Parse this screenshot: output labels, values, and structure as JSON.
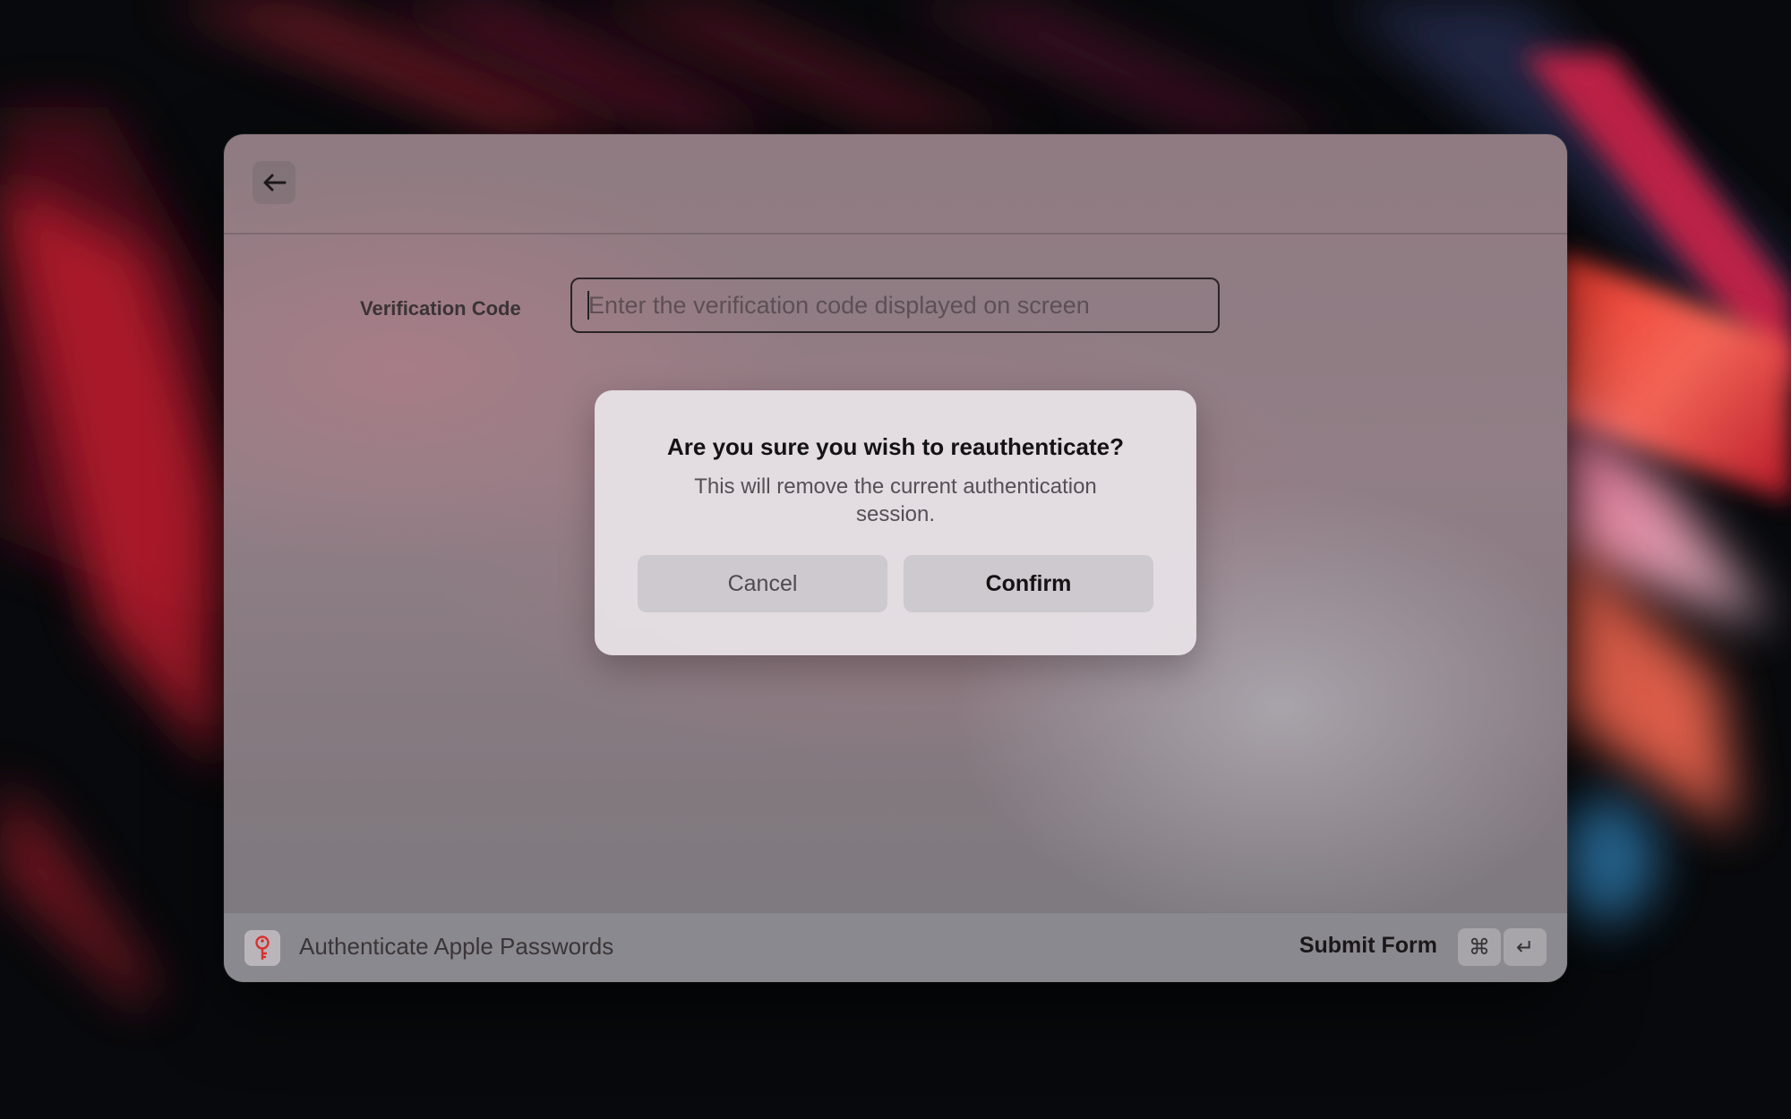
{
  "window": {
    "back_icon": "arrow-left-icon"
  },
  "form": {
    "verification_label": "Verification Code",
    "verification_placeholder": "Enter the verification code displayed on screen",
    "verification_value": ""
  },
  "dialog": {
    "title": "Are you sure you wish to reauthenticate?",
    "message": "This will remove the current authentication session.",
    "cancel_label": "Cancel",
    "confirm_label": "Confirm"
  },
  "footer": {
    "app_icon": "key-icon",
    "title": "Authenticate Apple Passwords",
    "action_label": "Submit Form",
    "shortcut_keys": [
      "⌘",
      "↵"
    ]
  },
  "colors": {
    "accent_red": "#e03a32",
    "dialog_bg": "#e5dfe4",
    "button_bg": "#cdc9ce"
  }
}
